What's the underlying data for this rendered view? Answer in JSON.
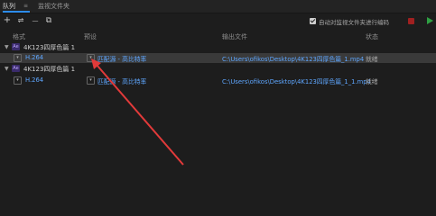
{
  "tabs": [
    {
      "label": "队列",
      "menu": "≡"
    },
    {
      "label": "监视文件夹"
    }
  ],
  "toolbar": {
    "add_glyph": "+",
    "settings_glyph": "⇌",
    "remove_glyph": "—",
    "duplicate_glyph": "⧉",
    "auto_encode_label": "自动对监视文件夹进行编码",
    "auto_encode_checked": true
  },
  "columns": [
    "格式",
    "预设",
    "输出文件",
    "状态"
  ],
  "groups": [
    {
      "name": "4K123四厚色篇 1",
      "status": "",
      "item": {
        "format": "H.264",
        "preset": "匹配源 - 高比特率",
        "output": "C:\\Users\\ofikos\\Desktop\\4K123四厚色篇_1.mp4",
        "status": "就绪"
      }
    },
    {
      "name": "4K123四厚色篇 1",
      "status": "",
      "item": {
        "format": "H.264",
        "preset": "匹配源 - 高比特率",
        "output": "C:\\Users\\ofikos\\Desktop\\4K123四厚色篇_1_1.mp4",
        "status": "就绪"
      }
    }
  ],
  "colors": {
    "accent": "#2d8ceb",
    "link": "#5fa7ff",
    "stop": "#a02020",
    "start": "#2ea043",
    "annotation_arrow": "#e23a3a"
  },
  "icons": [
    "add-icon",
    "settings-icon",
    "remove-icon",
    "duplicate-icon",
    "stop-icon",
    "play-icon",
    "after-effects-icon",
    "chevron-down-icon"
  ]
}
